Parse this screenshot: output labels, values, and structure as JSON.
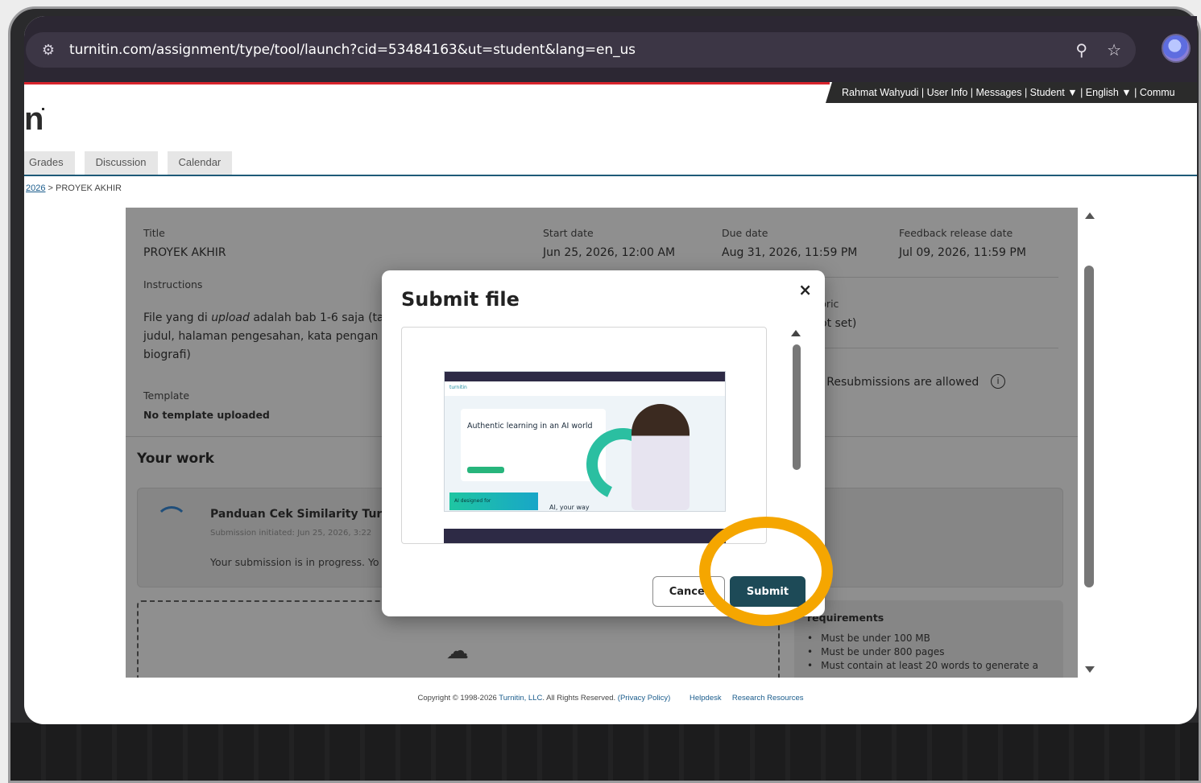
{
  "browser": {
    "url": "turnitin.com/assignment/type/tool/launch?cid=53484163&ut=student&lang=en_us",
    "icons": [
      "tune-icon",
      "zoom-icon",
      "star-icon",
      "profile-avatar"
    ]
  },
  "topnav": {
    "text": "Rahmat Wahyudi | User Info | Messages | Student ▼ | English ▼ | Commu"
  },
  "logo_text": "n",
  "tabs": [
    "Grades",
    "Discussion",
    "Calendar"
  ],
  "breadcrumb": {
    "link": "2026",
    "current": "> PROYEK AKHIR"
  },
  "assignment": {
    "title_label": "Title",
    "title": "PROYEK AKHIR",
    "start_label": "Start date",
    "start": "Jun 25, 2026, 12:00 AM",
    "due_label": "Due date",
    "due": "Aug 31, 2026, 11:59 PM",
    "feedback_label": "Feedback release date",
    "feedback": "Jul 09, 2026, 11:59 PM",
    "instructions_label": "Instructions",
    "instructions_line1_a": "File yang di ",
    "instructions_line1_em": "upload",
    "instructions_line1_b": "  adalah bab 1-6 saja (ta",
    "instructions_line2": "judul, halaman pengesahan, kata pengan",
    "instructions_line3": "biografi)",
    "rubric_label": "bric",
    "rubric_value": "ot set)",
    "resubmission": "' Resubmissions are allowed",
    "template_label": "Template",
    "template_value": "No template uploaded"
  },
  "your_work": {
    "heading": "Your work",
    "submission_title": "Panduan Cek Similarity Turni",
    "submission_meta": "Submission initiated: Jun 25, 2026, 3:22",
    "submission_status": "Your submission is in progress. Yo"
  },
  "requirements": {
    "heading": "requirements",
    "items": [
      "Must be under 100 MB",
      "Must be under 800 pages",
      "Must contain at least 20 words to generate a"
    ]
  },
  "modal": {
    "title": "Submit file",
    "close_label": "×",
    "cancel_label": "Cancel",
    "submit_label": "Submit",
    "preview": {
      "headline": "Authentic learning in an AI world",
      "tag": "AI designed for",
      "subline": "AI, your way"
    }
  },
  "footer": {
    "copyright": "Copyright © 1998-2026 ",
    "company_link": "Turnitin, LLC",
    "rights": ". All Rights Reserved. ",
    "privacy": "(Privacy Policy)",
    "helpdesk": "Helpdesk",
    "research": "Research Resources"
  },
  "colors": {
    "accent_red": "#d8242c",
    "submit_button": "#1d4a57",
    "highlight_ring": "#f5a600"
  }
}
